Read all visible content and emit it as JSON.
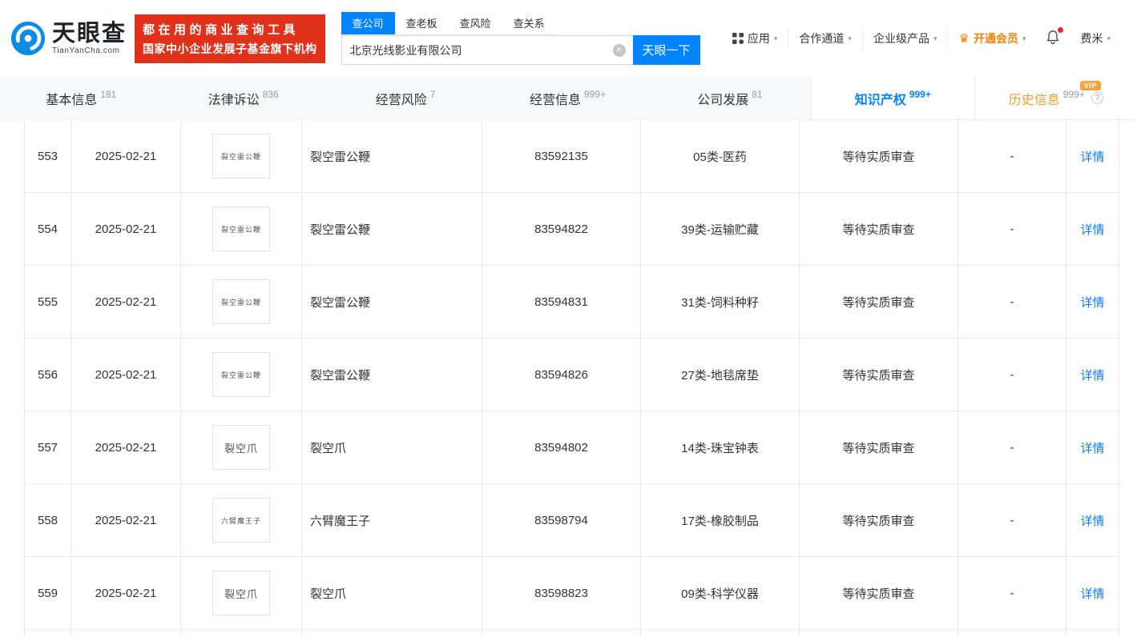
{
  "colors": {
    "accent": "#0084ff",
    "banner_red": "#e0311a",
    "member_orange": "#ff8000",
    "vip_badge": "#ffa13a",
    "link_blue": "#0b7cf8"
  },
  "brand": {
    "name": "天眼查",
    "domain": "TianYanCha.com",
    "slogan_line1": "都在用的商业查询工具",
    "slogan_line2": "国家中小企业发展子基金旗下机构"
  },
  "search": {
    "tabs": [
      {
        "label": "查公司"
      },
      {
        "label": "查老板"
      },
      {
        "label": "查风险"
      },
      {
        "label": "查关系"
      }
    ],
    "value": "北京光线影业有限公司",
    "button_label": "天眼一下"
  },
  "topnav": {
    "app": "应用",
    "coop": "合作通道",
    "enterprise": "企业级产品",
    "member": "开通会员",
    "user": "费米"
  },
  "section_tabs": [
    {
      "label": "基本信息",
      "count": "181"
    },
    {
      "label": "法律诉讼",
      "count": "836"
    },
    {
      "label": "经营风险",
      "count": "7"
    },
    {
      "label": "经营信息",
      "count": "999+"
    },
    {
      "label": "公司发展",
      "count": "81"
    },
    {
      "label": "知识产权",
      "count": "999+"
    },
    {
      "label": "历史信息",
      "count": "999+",
      "badge": "VIP",
      "help": "?"
    }
  ],
  "table": {
    "rows": [
      {
        "no": "553",
        "date": "2025-02-21",
        "image_text": "裂空雷公鞭",
        "name": "裂空雷公鞭",
        "reg_no": "83592135",
        "category": "05类-医药",
        "status": "等待实质审查",
        "extra": "-",
        "action": "详情"
      },
      {
        "no": "554",
        "date": "2025-02-21",
        "image_text": "裂空雷公鞭",
        "name": "裂空雷公鞭",
        "reg_no": "83594822",
        "category": "39类-运输贮藏",
        "status": "等待实质审查",
        "extra": "-",
        "action": "详情"
      },
      {
        "no": "555",
        "date": "2025-02-21",
        "image_text": "裂空雷公鞭",
        "name": "裂空雷公鞭",
        "reg_no": "83594831",
        "category": "31类-饲料种籽",
        "status": "等待实质审查",
        "extra": "-",
        "action": "详情"
      },
      {
        "no": "556",
        "date": "2025-02-21",
        "image_text": "裂空雷公鞭",
        "name": "裂空雷公鞭",
        "reg_no": "83594826",
        "category": "27类-地毯席垫",
        "status": "等待实质审查",
        "extra": "-",
        "action": "详情"
      },
      {
        "no": "557",
        "date": "2025-02-21",
        "image_text": "裂空爪",
        "name": "裂空爪",
        "reg_no": "83594802",
        "category": "14类-珠宝钟表",
        "status": "等待实质审查",
        "extra": "-",
        "action": "详情"
      },
      {
        "no": "558",
        "date": "2025-02-21",
        "image_text": "六臂魔王子",
        "name": "六臂魔王子",
        "reg_no": "83598794",
        "category": "17类-橡胶制品",
        "status": "等待实质审查",
        "extra": "-",
        "action": "详情"
      },
      {
        "no": "559",
        "date": "2025-02-21",
        "image_text": "裂空爪",
        "name": "裂空爪",
        "reg_no": "83598823",
        "category": "09类-科学仪器",
        "status": "等待实质审查",
        "extra": "-",
        "action": "详情"
      }
    ]
  }
}
